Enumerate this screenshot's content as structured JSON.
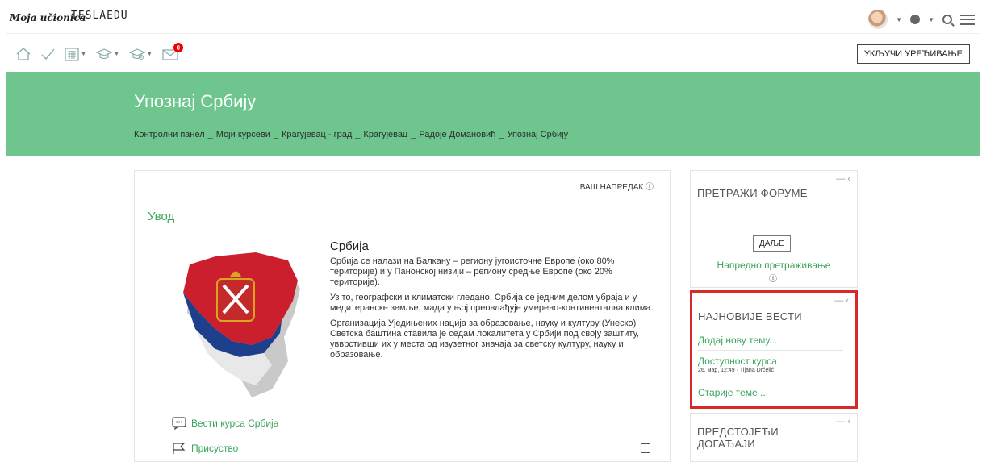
{
  "header": {
    "brand_script": "Moja učionica",
    "brand_logo": "TESLAEDU"
  },
  "toolbar": {
    "icons": [
      "home-icon",
      "check-icon",
      "calendar-icon",
      "graduation-cap-icon",
      "graduation-cap-settings-icon",
      "mail-icon"
    ],
    "mail_badge": "0",
    "edit_button": "УКЉУЧИ УРЕЂИВАЊЕ"
  },
  "course": {
    "title": "Упознај Србију",
    "breadcrumb": [
      "Контролни панел",
      "Моји курсеви",
      "Крагујевац - град",
      "Крагујевац",
      "Радоје Домановић",
      "Упознај Србију"
    ]
  },
  "main": {
    "progress_label": "ВАШ НАПРЕДАК",
    "section_title": "Увод",
    "article_title": "Србија",
    "paragraphs": [
      "Србија се налази на Балкану – региону југоисточне Европе (око 80% територије) и у Панонској низији – региону средње Европе (око 20% територије).",
      "Уз то, географски и климатски гледано, Србија се једним делом убраја и у медитеранске земље, мада у њој преовлађује умерено-континентална клима.",
      "Организација Уједињених нација за образовање, науку и културу (Унеско) Светска баштина ставила је седам локалитета у Србији под своју заштиту, увврстивши их у места од изузетног значаја за светску културу, науку и образовање."
    ],
    "activities": [
      {
        "label": "Вести курса Србија",
        "icon": "forum-icon"
      },
      {
        "label": "Присуство",
        "icon": "flag-icon"
      }
    ]
  },
  "blocks": {
    "search_forums": {
      "title": "ПРЕТРАЖИ ФОРУМЕ",
      "go_label": "ДАЉЕ",
      "advanced_label": "Напредно претраживање"
    },
    "latest_news": {
      "title": "НАЈНОВИЈЕ ВЕСТИ",
      "add_topic": "Додај нову тему...",
      "item_title": "Доступност курса",
      "item_meta": "26. мар, 12:49 · Tijana Drčelić",
      "older": "Старије теме ..."
    },
    "upcoming_events": {
      "title": "ПРЕДСТОЈЕЋИ ДОГАЂАЈИ"
    }
  },
  "colors": {
    "accent_green": "#6ec68e",
    "link_green": "#3aa55b",
    "highlight_red": "#d92a2a"
  }
}
